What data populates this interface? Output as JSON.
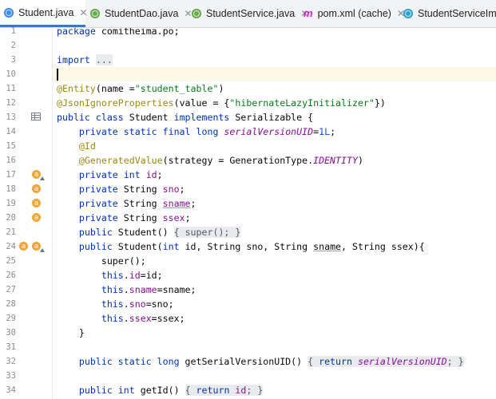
{
  "tabs": [
    {
      "label": "Student.java",
      "icon": "java-class-icon",
      "active": true,
      "close": "✕"
    },
    {
      "label": "StudentDao.java",
      "icon": "java-interface-icon",
      "active": false,
      "close": "✕"
    },
    {
      "label": "StudentService.java",
      "icon": "java-interface-icon",
      "active": false,
      "close": "✕"
    },
    {
      "label": "pom.xml (cache)",
      "icon": "maven-icon",
      "active": false,
      "close": "✕"
    },
    {
      "label": "StudentServiceImpl.",
      "icon": "java-class-icon",
      "active": false,
      "close": ""
    }
  ],
  "maven_glyph": "m",
  "line_numbers": [
    "1",
    "2",
    "3",
    "10",
    "11",
    "12",
    "13",
    "14",
    "15",
    "16",
    "17",
    "18",
    "19",
    "20",
    "21",
    "24",
    "25",
    "26",
    "27",
    "28",
    "29",
    "30",
    "31",
    "32",
    "33",
    "34"
  ],
  "code": {
    "l1": [
      "package",
      " comitheima.po;"
    ],
    "l3": [
      "import",
      " ",
      "..."
    ],
    "l11": [
      "@Entity",
      "(name =",
      "\"student_table\"",
      ")"
    ],
    "l12": [
      "@JsonIgnoreProperties",
      "(value = {",
      "\"hibernateLazyInitializer\"",
      "})"
    ],
    "l13": [
      "public class",
      " Student ",
      "implements",
      " Serializable {"
    ],
    "l14": [
      "    ",
      "private static final long",
      " ",
      "serialVersionUID",
      "=",
      "1L",
      ";"
    ],
    "l15": [
      "    ",
      "@Id"
    ],
    "l16": [
      "    ",
      "@GeneratedValue",
      "(strategy = GenerationType.",
      "IDENTITY",
      ")"
    ],
    "l17": [
      "    ",
      "private int",
      " ",
      "id",
      ";"
    ],
    "l18": [
      "    ",
      "private",
      " String ",
      "sno",
      ";"
    ],
    "l19": [
      "    ",
      "private",
      " String ",
      "sname",
      ";"
    ],
    "l20": [
      "    ",
      "private",
      " String ",
      "ssex",
      ";"
    ],
    "l21": [
      "    ",
      "public",
      " Student",
      "()",
      " ",
      "{ super(); }"
    ],
    "l24": [
      "    ",
      "public",
      " Student",
      "(",
      "int",
      " id, String sno, String ",
      "sname",
      ", String ssex){"
    ],
    "l25": [
      "        super();"
    ],
    "l26": [
      "        ",
      "this",
      ".",
      "id",
      "=id;"
    ],
    "l27": [
      "        ",
      "this",
      ".",
      "sname",
      "=sname;"
    ],
    "l28": [
      "        ",
      "this",
      ".",
      "sno",
      "=sno;"
    ],
    "l29": [
      "        ",
      "this",
      ".",
      "ssex",
      "=ssex;"
    ],
    "l30": [
      "    }"
    ],
    "l33": [
      "    ",
      "public static long",
      " ",
      "getSerialVersionUID",
      "()",
      " ",
      "{ ",
      "return",
      " ",
      "serialVersionUID",
      "; }"
    ],
    "l34": [
      "    ",
      "public int",
      " ",
      "getId",
      "()",
      " ",
      "{ ",
      "return",
      " ",
      "id",
      "; }"
    ]
  },
  "gutter_marks": {
    "letter": "a"
  },
  "colors": {
    "keyword": "#0033b3",
    "annotation": "#9e880d",
    "string": "#067d17",
    "field": "#871094",
    "number": "#1750eb",
    "tab_accent": "#3574f0"
  }
}
